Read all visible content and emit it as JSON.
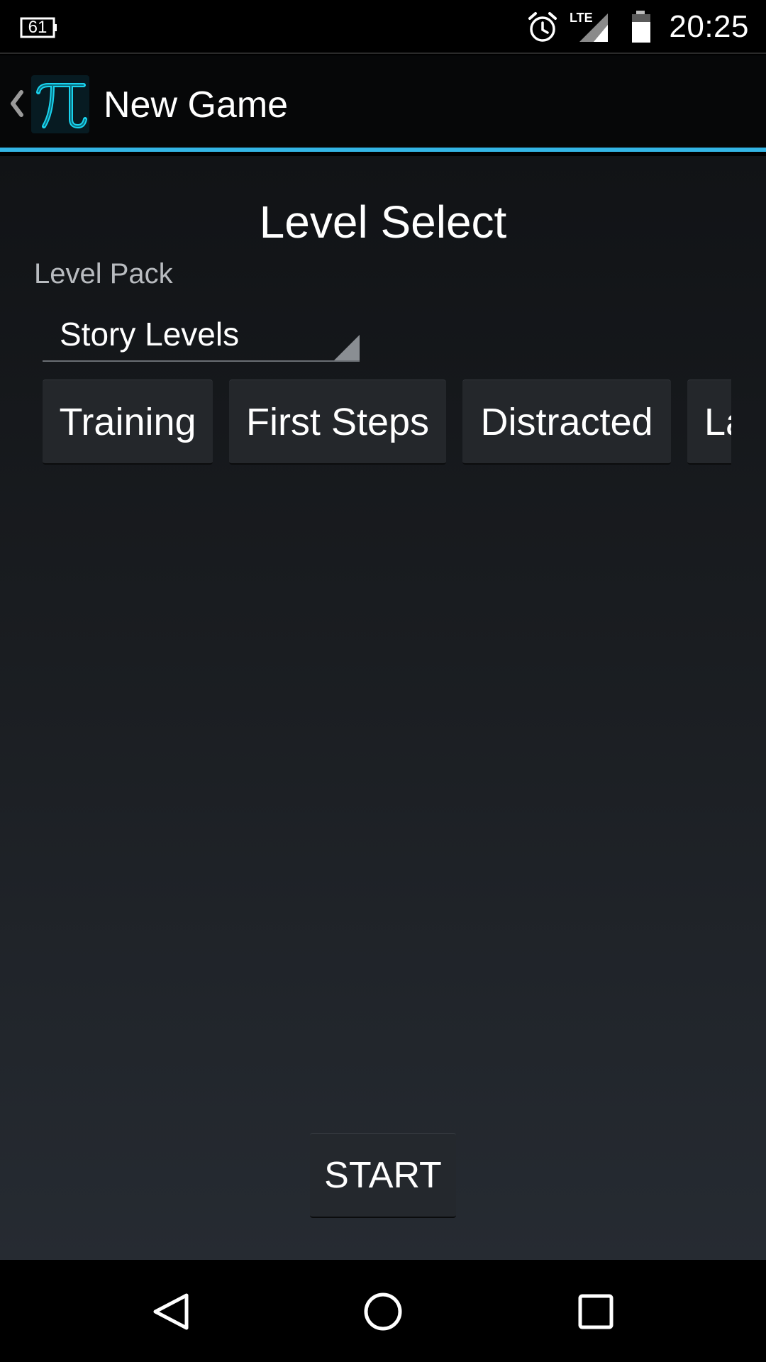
{
  "status_bar": {
    "notification_badge": "61",
    "network_label": "LTE",
    "time": "20:25",
    "icons": [
      "notification-badge-icon",
      "alarm-icon",
      "lte-signal-icon",
      "battery-icon"
    ]
  },
  "action_bar": {
    "up_icon": "chevron-left-icon",
    "app_icon": "pi-icon",
    "title": "New Game",
    "accent_color": "#33b5e5"
  },
  "main": {
    "title": "Level Select",
    "level_pack_label": "Level Pack",
    "level_pack_selected": "Story Levels",
    "levels": [
      {
        "label": "Training"
      },
      {
        "label": "First Steps"
      },
      {
        "label": "Distracted"
      },
      {
        "label": "La"
      }
    ],
    "start_label": "START"
  },
  "nav_bar": {
    "icons": [
      "back-triangle-icon",
      "home-circle-icon",
      "recents-square-icon"
    ]
  }
}
